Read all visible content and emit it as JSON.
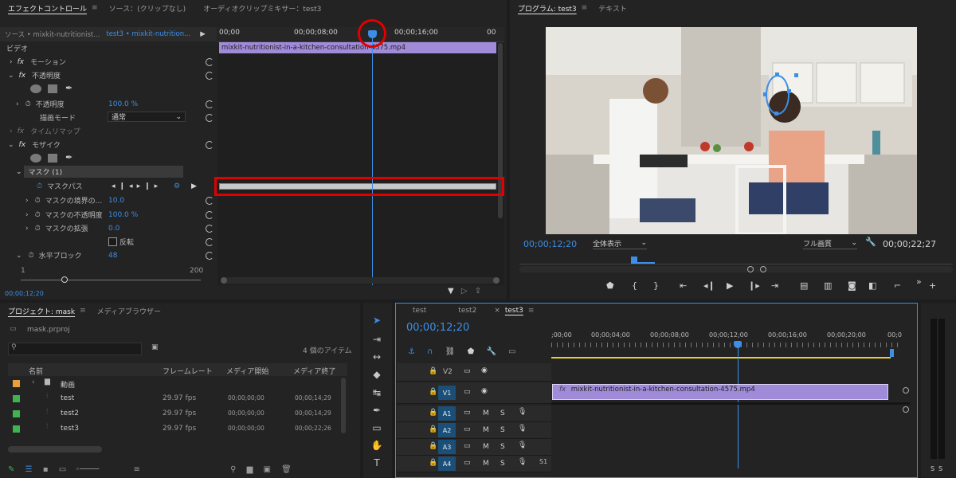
{
  "effect_controls": {
    "tabs": [
      "エフェクトコントロール",
      "ソース：(クリップなし)",
      "オーディオクリップミキサー：test3"
    ],
    "source_label": "ソース • mixkit-nutritionist...",
    "sequence_label": "test3 • mixkit-nutrition...",
    "ruler": [
      "00;00",
      "00;00;08;00",
      "00;00;16;00",
      "00"
    ],
    "clip_name": "mixkit-nutritionist-in-a-kitchen-consultation-4575.mp4",
    "section_video": "ビデオ",
    "motion": "モーション",
    "opacity": "不透明度",
    "opacity_label": "不透明度",
    "opacity_value": "100.0 %",
    "blend_mode_label": "描画モード",
    "blend_mode_value": "通常",
    "time_remap": "タイムリマップ",
    "mosaic": "モザイク",
    "mask_name": "マスク (1)",
    "mask_path": "マスクパス",
    "mask_feather_label": "マスクの境界の...",
    "mask_feather_value": "10.0",
    "mask_opacity_label": "マスクの不透明度",
    "mask_opacity_value": "100.0 %",
    "mask_expansion_label": "マスクの拡張",
    "mask_expansion_value": "0.0",
    "inverted_label": "反転",
    "h_blocks_label": "水平ブロック",
    "h_blocks_value": "48",
    "slider_min": "1",
    "slider_max": "200",
    "timecode": "00;00;12;20"
  },
  "program": {
    "tab_program": "プログラム: test3",
    "tab_text": "テキスト",
    "timecode_current": "00;00;12;20",
    "fit_label": "全体表示",
    "quality_label": "フル画質",
    "timecode_duration": "00;00;22;27"
  },
  "project": {
    "tab_project": "プロジェクト: mask",
    "tab_media": "メディアブラウザー",
    "file_name": "mask.prproj",
    "item_count": "4 個のアイテム",
    "columns": [
      "名前",
      "フレームレート",
      "メディア開始",
      "メディア終了"
    ],
    "folder": "動画",
    "items": [
      {
        "name": "test",
        "rate": "29.97 fps",
        "start": "00;00;00;00",
        "end": "00;00;14;29",
        "color": "#3fb34f"
      },
      {
        "name": "test2",
        "rate": "29.97 fps",
        "start": "00;00;00;00",
        "end": "00;00;14;29",
        "color": "#3fb34f"
      },
      {
        "name": "test3",
        "rate": "29.97 fps",
        "start": "00;00;00;00",
        "end": "00;00;22;26",
        "color": "#3fb34f"
      }
    ]
  },
  "timeline": {
    "tabs": [
      "test",
      "test2",
      "test3"
    ],
    "timecode": "00;00;12;20",
    "ruler": [
      ";00;00",
      "00;00;04;00",
      "00;00;08;00",
      "00;00;12;00",
      "00;00;16;00",
      "00;00;20;00",
      "00;0"
    ],
    "video_tracks": [
      "V2",
      "V1"
    ],
    "audio_tracks": [
      "A1",
      "A2",
      "A3",
      "A4"
    ],
    "mute_label": "M",
    "solo_label": "S",
    "clip_name": "mixkit-nutritionist-in-a-kitchen-consultation-4575.mp4",
    "audio_sync_label": "S1"
  },
  "meter": {
    "labels": [
      "S",
      "S"
    ]
  },
  "colors": {
    "accent": "#3d8ee6",
    "clip": "#a08bd8",
    "highlight": "#e00000"
  }
}
